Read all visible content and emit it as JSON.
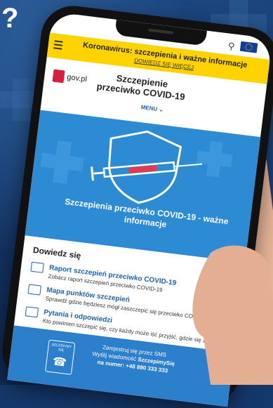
{
  "background": {
    "question_mark": "?"
  },
  "banner": {
    "title": "Koronawirus: szczepienia i ważne informacje",
    "link": "DOWIEDZ SIĘ WIĘCEJ"
  },
  "header": {
    "logo_text": "gov.pl",
    "title": "Szczepienie przeciwko COVID-19",
    "menu_label": "MENU"
  },
  "hero": {
    "title": "Szczepienia przeciwko COVID-19 - ważne informacje"
  },
  "links": {
    "heading": "Dowiedz się",
    "items": [
      {
        "label": "Raport szczepień przeciwko COVID-19",
        "desc": "Zobacz raport szczepień przeciwko COVID-19"
      },
      {
        "label": "Mapa punktów szczepień",
        "desc": "Sprawdź gdzie będziesz mógł zaszczepić się przeciwko COVID-19"
      },
      {
        "label": "Pytania i odpowiedzi",
        "desc": "Kto powinien szczepić się, czy każdy może iść przyjść, gdzie się zgłosić"
      }
    ]
  },
  "footer": {
    "badge": "SZCZEPIMY SIĘ",
    "line1": "Zarejestruj się przez SMS",
    "line2": "Wyślij wiadomość",
    "line2_bold": "SzczepimySię",
    "line3": "na numer: +48 880 333 333"
  },
  "colors": {
    "accent": "#1f63b5",
    "banner": "#ffd300",
    "hero": "#2c8bd3",
    "brand_red": "#d4213d"
  }
}
